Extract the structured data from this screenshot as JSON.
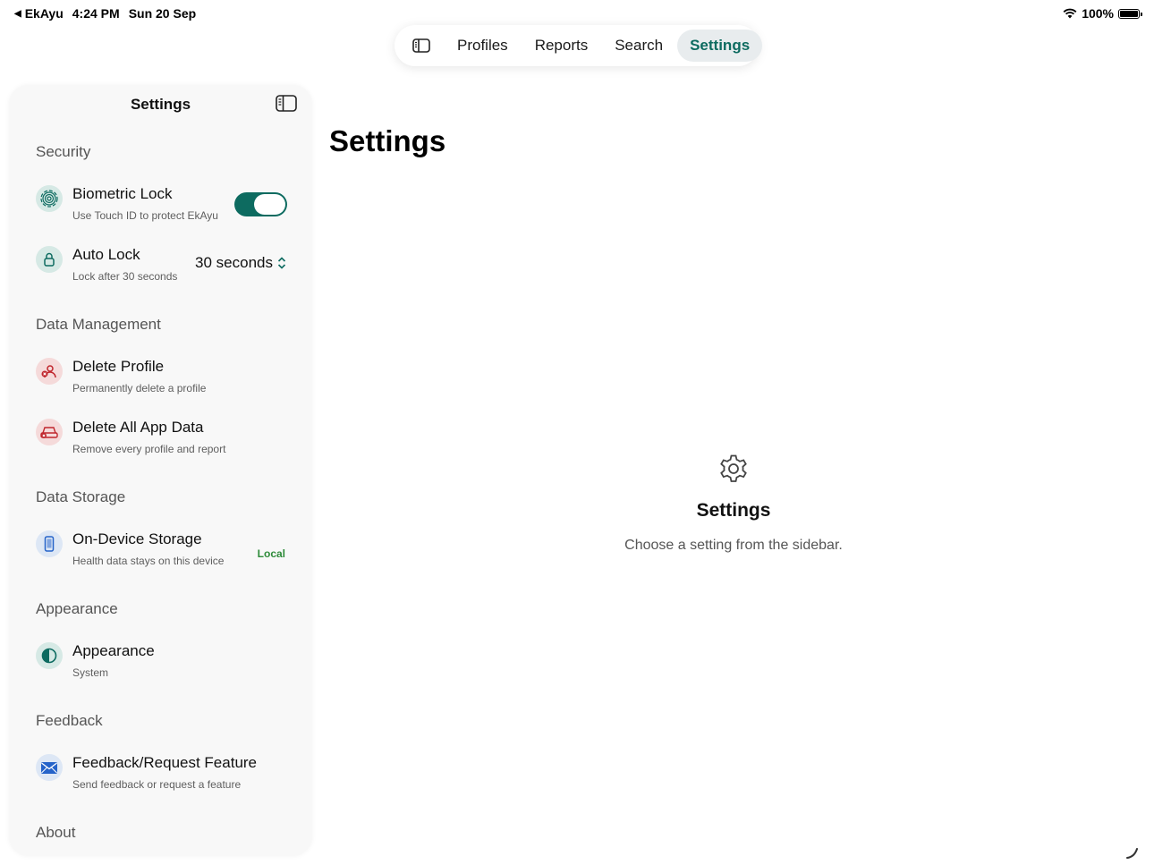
{
  "status_bar": {
    "back_app": "EkAyu",
    "time": "4:24 PM",
    "date": "Sun 20 Sep",
    "battery": "100%",
    "icons": [
      "back-arrow-icon",
      "wifi-icon",
      "battery-icon"
    ]
  },
  "tabbar": {
    "sidebar_toggle_icon": "sidebar-icon",
    "tabs": [
      {
        "label": "Profiles",
        "active": false
      },
      {
        "label": "Reports",
        "active": false
      },
      {
        "label": "Search",
        "active": false
      },
      {
        "label": "Settings",
        "active": true
      }
    ]
  },
  "sidebar": {
    "title": "Settings",
    "toggle_icon": "sidebar-icon",
    "sections": {
      "security": {
        "title": "Security",
        "biometric": {
          "title": "Biometric Lock",
          "subtitle": "Use Touch ID to protect EkAyu",
          "icon": "fingerprint-icon",
          "enabled": true
        },
        "auto_lock": {
          "title": "Auto Lock",
          "subtitle": "Lock after 30 seconds",
          "icon": "lock-icon",
          "value": "30 seconds"
        }
      },
      "data_management": {
        "title": "Data Management",
        "delete_profile": {
          "title": "Delete Profile",
          "subtitle": "Permanently delete a profile",
          "icon": "delete-person-icon"
        },
        "delete_all": {
          "title": "Delete All App Data",
          "subtitle": "Remove every profile and report",
          "icon": "delete-storage-icon"
        }
      },
      "data_storage": {
        "title": "Data Storage",
        "on_device": {
          "title": "On-Device Storage",
          "subtitle": "Health data stays on this device",
          "icon": "device-icon",
          "badge": "Local"
        }
      },
      "appearance": {
        "title": "Appearance",
        "appearance": {
          "title": "Appearance",
          "subtitle": "System",
          "icon": "half-circle-icon"
        }
      },
      "feedback": {
        "title": "Feedback",
        "feedback": {
          "title": "Feedback/Request Feature",
          "subtitle": "Send feedback or request a feature",
          "icon": "envelope-icon"
        }
      },
      "about": {
        "title": "About"
      }
    }
  },
  "detail": {
    "title": "Settings",
    "empty_state": {
      "icon": "gear-icon",
      "title": "Settings",
      "subtitle": "Choose a setting from the sidebar."
    }
  },
  "colors": {
    "accent": "#0d6b60",
    "destructive": "#c0262d",
    "local_badge": "#2e8b3a",
    "sidebar_bg": "#f8f8f8"
  }
}
